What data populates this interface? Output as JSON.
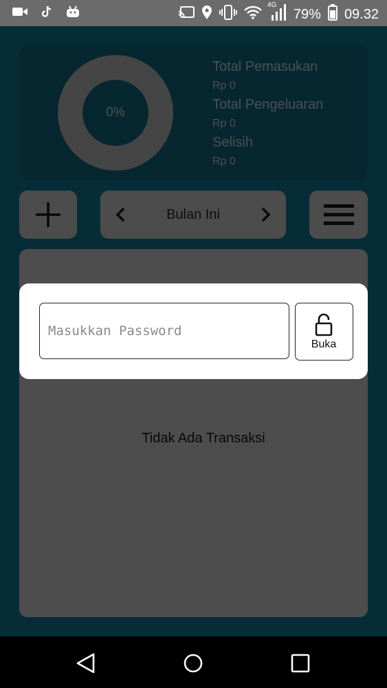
{
  "status_bar": {
    "battery": "79%",
    "time": "09.32",
    "network": "4G",
    "icons_left": [
      "video-icon",
      "tiktok-icon",
      "android-icon"
    ],
    "icons_right": [
      "cast-icon",
      "location-icon",
      "vibrate-icon",
      "wifi-icon",
      "signal-icon",
      "battery-icon"
    ]
  },
  "summary": {
    "percent": "0%",
    "income_title": "Total Pemasukan",
    "income_value": "Rp 0",
    "expense_title": "Total Pengeluaran",
    "expense_value": "Rp 0",
    "diff_title": "Selisih",
    "diff_value": "Rp 0"
  },
  "controls": {
    "month_label": "Bulan Ini"
  },
  "transactions": {
    "empty_text": "Tidak Ada Transaksi"
  },
  "password_dialog": {
    "placeholder": "Masukkan Password",
    "value": "",
    "open_label": "Buka"
  },
  "colors": {
    "app_bg": "#0c5a6f",
    "card_bg": "#0e4e61",
    "button_bg": "#989898",
    "dialog_bg": "#ffffff"
  }
}
